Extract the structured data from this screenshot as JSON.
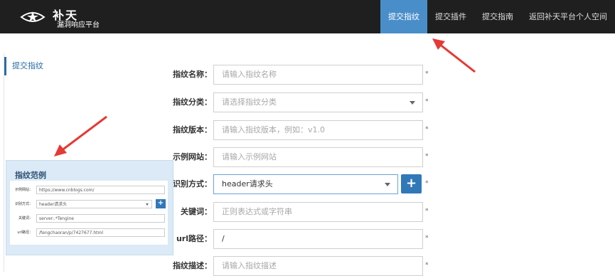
{
  "header": {
    "logo_title": "补天",
    "logo_subtitle": "漏洞响应平台",
    "nav": [
      {
        "label": "提交指纹",
        "active": true
      },
      {
        "label": "提交插件",
        "active": false
      },
      {
        "label": "提交指南",
        "active": false
      },
      {
        "label": "返回补天平台个人空间",
        "active": false
      }
    ]
  },
  "sidebar": {
    "link_label": "提交指纹"
  },
  "form": {
    "required_mark": "*",
    "fields": [
      {
        "label": "指纹名称：",
        "placeholder": "请输入指纹名称"
      },
      {
        "label": "指纹分类：",
        "placeholder": "请选择指纹分类"
      },
      {
        "label": "指纹版本：",
        "placeholder": "请输入指纹版本，例如：v1.0"
      },
      {
        "label": "示例网站：",
        "placeholder": "请输入示例网站"
      },
      {
        "label": "识别方式：",
        "value": "header请求头"
      },
      {
        "label": "关键词：",
        "placeholder": "正则表达式或字符串"
      },
      {
        "label": "url路径：",
        "value": "/"
      },
      {
        "label": "指纹描述：",
        "placeholder": "请输入指纹描述"
      }
    ],
    "add_button_label": "+"
  },
  "example": {
    "title": "指纹范例",
    "rows": [
      {
        "label": "示例网站：",
        "value": "https://www.cnblogs.com/"
      },
      {
        "label": "识别方式：",
        "value": "header请求头"
      },
      {
        "label": "关键词：",
        "value": "server:.*Tengine"
      },
      {
        "label": "url路径：",
        "value": "/fengchaoran/p/7427677.html"
      }
    ],
    "add_button_label": "+"
  },
  "colors": {
    "topbar": "#1f1f1f",
    "nav_active": "#4a8ec9",
    "button": "#3178b9",
    "arrow": "#e53935",
    "example_bg": "#dbeaf6"
  }
}
